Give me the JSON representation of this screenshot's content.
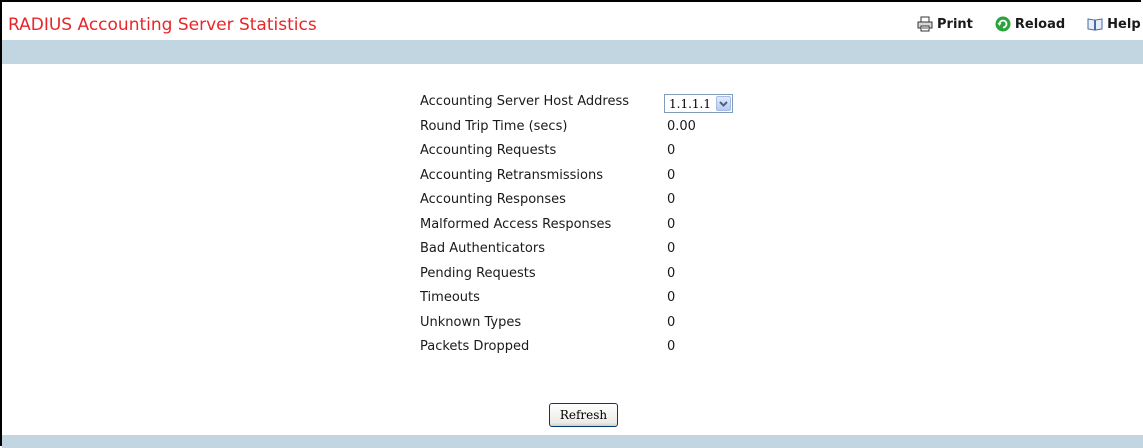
{
  "page": {
    "title": "RADIUS Accounting Server Statistics"
  },
  "toolbar": {
    "print_label": "Print",
    "reload_label": "Reload",
    "help_label": "Help"
  },
  "icons": {
    "print": "printer-icon",
    "reload": "reload-icon",
    "help": "book-icon"
  },
  "colors": {
    "title": "#e8262a",
    "band": "#c1d6e1",
    "reload_icon": "#2aa33a"
  },
  "form": {
    "host_address_label": "Accounting Server Host Address",
    "host_address_selected": "1.1.1.1"
  },
  "stats": [
    {
      "label": "Round Trip Time (secs)",
      "value": "0.00"
    },
    {
      "label": "Accounting Requests",
      "value": "0"
    },
    {
      "label": "Accounting Retransmissions",
      "value": "0"
    },
    {
      "label": "Accounting Responses",
      "value": "0"
    },
    {
      "label": "Malformed Access Responses",
      "value": "0"
    },
    {
      "label": "Bad Authenticators",
      "value": "0"
    },
    {
      "label": "Pending Requests",
      "value": "0"
    },
    {
      "label": "Timeouts",
      "value": "0"
    },
    {
      "label": "Unknown Types",
      "value": "0"
    },
    {
      "label": "Packets Dropped",
      "value": "0"
    }
  ],
  "actions": {
    "refresh_label": "Refresh"
  }
}
